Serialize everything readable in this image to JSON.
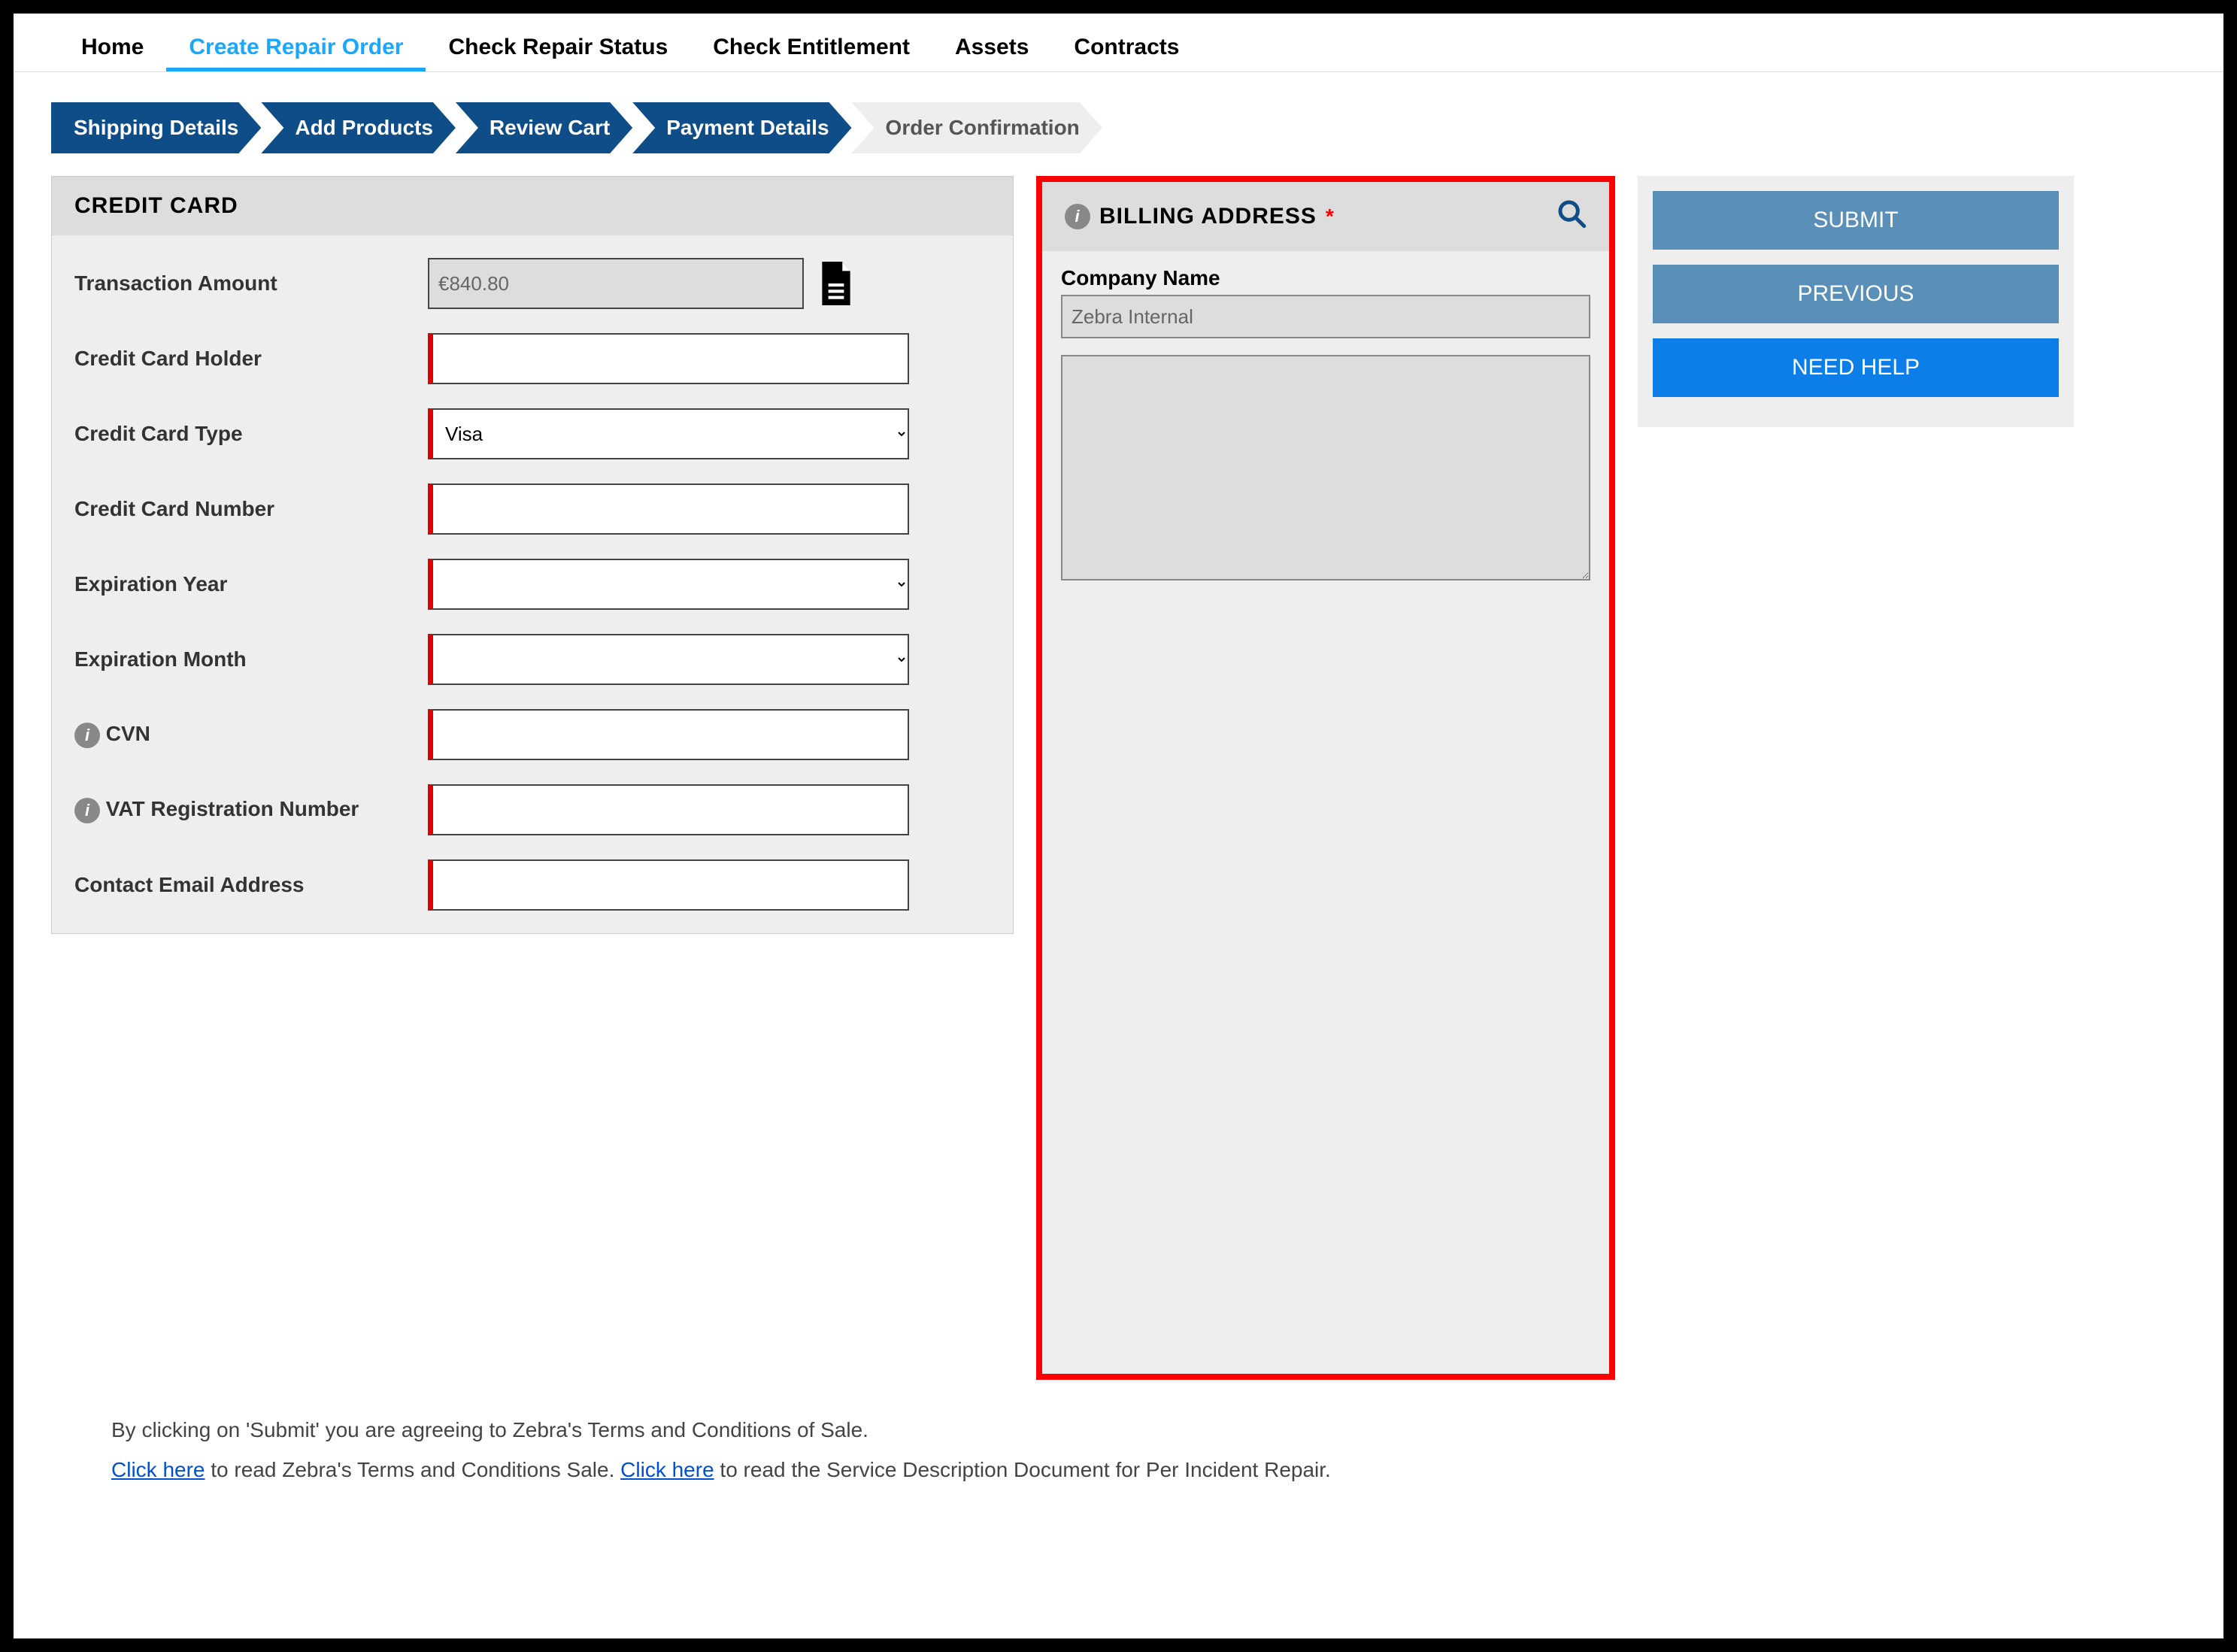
{
  "nav": {
    "home": "Home",
    "create": "Create Repair Order",
    "check_status": "Check Repair Status",
    "check_entitlement": "Check Entitlement",
    "assets": "Assets",
    "contracts": "Contracts"
  },
  "steps": {
    "shipping": "Shipping Details",
    "add_products": "Add Products",
    "review": "Review Cart",
    "payment": "Payment Details",
    "confirmation": "Order Confirmation"
  },
  "credit_card": {
    "title": "CREDIT CARD",
    "transaction_amount_label": "Transaction Amount",
    "transaction_amount_value": "€840.80",
    "holder_label": "Credit Card Holder",
    "holder_value": "",
    "type_label": "Credit Card Type",
    "type_value": "Visa",
    "number_label": "Credit Card Number",
    "number_value": "",
    "exp_year_label": "Expiration Year",
    "exp_year_value": "",
    "exp_month_label": "Expiration Month",
    "exp_month_value": "",
    "cvn_label": "CVN",
    "cvn_value": "",
    "vat_label": "VAT Registration Number",
    "vat_value": "",
    "email_label": "Contact Email Address",
    "email_value": ""
  },
  "billing": {
    "title": "BILLING ADDRESS",
    "company_label": "Company Name",
    "company_value": "Zebra Internal",
    "address_value": ""
  },
  "actions": {
    "submit": "SUBMIT",
    "previous": "PREVIOUS",
    "help": "NEED HELP"
  },
  "footer": {
    "line1": "By clicking on 'Submit' you are agreeing to Zebra's Terms and Conditions of Sale.",
    "click_here1": "Click here",
    "mid1": " to read Zebra's Terms and Conditions Sale. ",
    "click_here2": "Click here",
    "mid2": " to read the Service Description Document for Per Incident Repair."
  }
}
